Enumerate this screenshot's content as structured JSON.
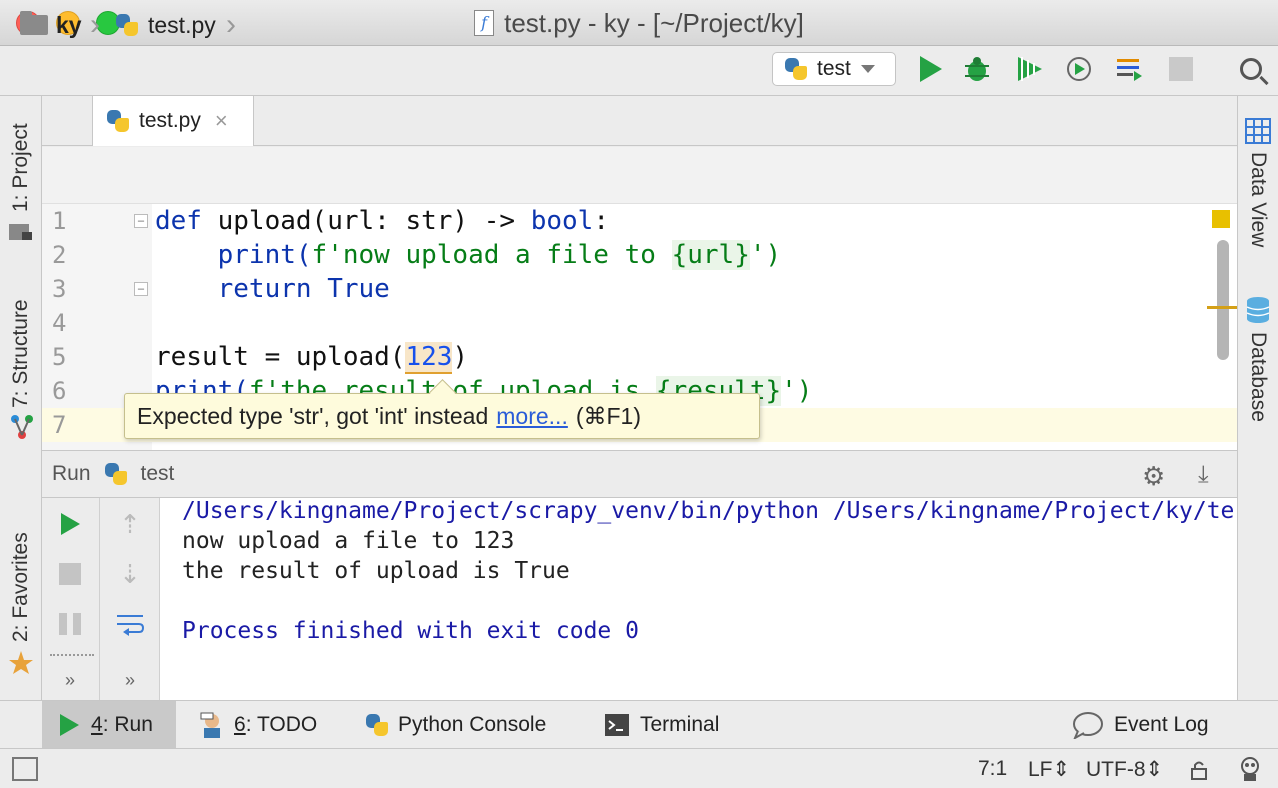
{
  "window": {
    "title": "test.py - ky - [~/Project/ky]"
  },
  "breadcrumb": {
    "project": "ky",
    "file": "test.py"
  },
  "toolbar": {
    "run_config": "test"
  },
  "side_tabs": {
    "left": [
      "1: Project",
      "7: Structure",
      "2: Favorites"
    ],
    "right": [
      "Data View",
      "Database"
    ]
  },
  "editor": {
    "tab_label": "test.py",
    "close_glyph": "×",
    "line_numbers": [
      "1",
      "2",
      "3",
      "4",
      "5",
      "6",
      "7"
    ],
    "lines": {
      "l1_kw": "def",
      "l1_rest": " upload(url: str) -> ",
      "l1_type": "bool",
      "l1_end": ":",
      "l2_call": "    print(",
      "l2_str": "f'now upload a file to ",
      "l2_interp": "{url}",
      "l2_end": "')",
      "l3_kw": "    return ",
      "l3_val": "True",
      "l5_pre": "result = upload(",
      "l5_arg": "123",
      "l5_end": ")",
      "l6_call": "print(",
      "l6_str": "f'the result of upload is ",
      "l6_interp": "{result}",
      "l6_end": "')"
    },
    "tooltip": {
      "message": "Expected type 'str', got 'int' instead",
      "link": "more...",
      "shortcut": "(⌘F1)"
    }
  },
  "run_panel": {
    "title": "Run",
    "config": "test",
    "console": [
      "/Users/kingname/Project/scrapy_venv/bin/python /Users/kingname/Project/ky/te",
      "now upload a file to 123",
      "the result of upload is True",
      "",
      "Process finished with exit code 0"
    ]
  },
  "bottom_tabs": {
    "run": {
      "key": "4",
      "label": ": Run"
    },
    "todo": {
      "key": "6",
      "label": ": TODO"
    },
    "python_console": "Python Console",
    "terminal": "Terminal",
    "event_log": "Event Log"
  },
  "status": {
    "position": "7:1",
    "line_sep": "LF",
    "encoding": "UTF-8"
  },
  "colors": {
    "keyword": "#0c34ad",
    "string": "#067d17",
    "run_green": "#25a244",
    "console_blue": "#1a1aa6"
  }
}
